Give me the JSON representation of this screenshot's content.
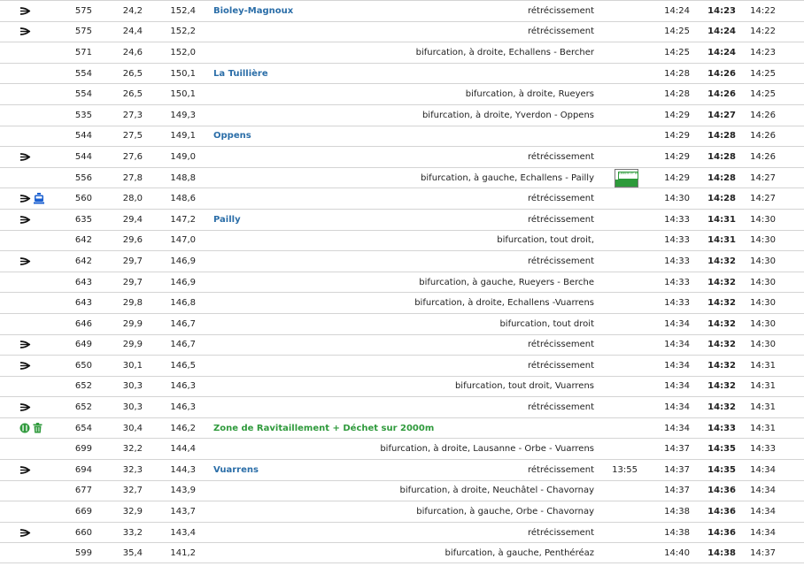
{
  "colors": {
    "place_blue": "#2b6ea8",
    "place_green": "#2f9a3c",
    "row_border": "#d4d4d4"
  },
  "rows": [
    {
      "icons": [
        "narrowing-icon"
      ],
      "alt": "575",
      "km": "24,2",
      "rem": "152,4",
      "place": "Bioley-Magnoux",
      "place_color": "blue",
      "desc": "rétrécissement",
      "t0": "",
      "t1": "14:24",
      "t2": "14:23",
      "t3": "14:22"
    },
    {
      "icons": [
        "narrowing-icon"
      ],
      "alt": "575",
      "km": "24,4",
      "rem": "152,2",
      "place": "",
      "desc": "rétrécissement",
      "t0": "",
      "t1": "14:25",
      "t2": "14:24",
      "t3": "14:22"
    },
    {
      "icons": [],
      "alt": "571",
      "km": "24,6",
      "rem": "152,0",
      "place": "",
      "desc": "bifurcation, à droite, Echallens - Bercher",
      "t0": "",
      "t1": "14:25",
      "t2": "14:24",
      "t3": "14:23"
    },
    {
      "icons": [],
      "alt": "554",
      "km": "26,5",
      "rem": "150,1",
      "place": "La Tuillière",
      "place_color": "blue",
      "desc": "",
      "t0": "",
      "t1": "14:28",
      "t2": "14:26",
      "t3": "14:25"
    },
    {
      "icons": [],
      "alt": "554",
      "km": "26,5",
      "rem": "150,1",
      "place": "",
      "desc": "bifurcation, à droite, Rueyers",
      "t0": "",
      "t1": "14:28",
      "t2": "14:26",
      "t3": "14:25"
    },
    {
      "icons": [],
      "alt": "535",
      "km": "27,3",
      "rem": "149,3",
      "place": "",
      "desc": "bifurcation, à droite, Yverdon - Oppens",
      "t0": "",
      "t1": "14:29",
      "t2": "14:27",
      "t3": "14:26"
    },
    {
      "icons": [],
      "alt": "544",
      "km": "27,5",
      "rem": "149,1",
      "place": "Oppens",
      "place_color": "blue",
      "desc": "",
      "t0": "",
      "t1": "14:29",
      "t2": "14:28",
      "t3": "14:26"
    },
    {
      "icons": [
        "narrowing-icon"
      ],
      "alt": "544",
      "km": "27,6",
      "rem": "149,0",
      "place": "",
      "desc": "rétrécissement",
      "t0": "",
      "t1": "14:29",
      "t2": "14:28",
      "t3": "14:26"
    },
    {
      "icons": [],
      "alt": "556",
      "km": "27,8",
      "rem": "148,8",
      "place": "",
      "desc": "bifurcation, à gauche, Echallens - Pailly",
      "badge": "canton-flag-icon",
      "badge_text": "LIBERTÉ ET PATRIE",
      "t0": "",
      "t1": "14:29",
      "t2": "14:28",
      "t3": "14:27"
    },
    {
      "icons": [
        "narrowing-icon",
        "tram-icon"
      ],
      "alt": "560",
      "km": "28,0",
      "rem": "148,6",
      "place": "",
      "desc": "rétrécissement",
      "t0": "",
      "t1": "14:30",
      "t2": "14:28",
      "t3": "14:27"
    },
    {
      "icons": [
        "narrowing-icon"
      ],
      "alt": "635",
      "km": "29,4",
      "rem": "147,2",
      "place": "Pailly",
      "place_color": "blue",
      "desc": "rétrécissement",
      "t0": "",
      "t1": "14:33",
      "t2": "14:31",
      "t3": "14:30"
    },
    {
      "icons": [],
      "alt": "642",
      "km": "29,6",
      "rem": "147,0",
      "place": "",
      "desc": "bifurcation, tout droit,",
      "t0": "",
      "t1": "14:33",
      "t2": "14:31",
      "t3": "14:30"
    },
    {
      "icons": [
        "narrowing-icon"
      ],
      "alt": "642",
      "km": "29,7",
      "rem": "146,9",
      "place": "",
      "desc": "rétrécissement",
      "t0": "",
      "t1": "14:33",
      "t2": "14:32",
      "t3": "14:30"
    },
    {
      "icons": [],
      "alt": "643",
      "km": "29,7",
      "rem": "146,9",
      "place": "",
      "desc": "bifurcation, à gauche, Rueyers - Berche",
      "t0": "",
      "t1": "14:33",
      "t2": "14:32",
      "t3": "14:30"
    },
    {
      "icons": [],
      "alt": "643",
      "km": "29,8",
      "rem": "146,8",
      "place": "",
      "desc": "bifurcation, à droite, Echallens -Vuarrens",
      "t0": "",
      "t1": "14:33",
      "t2": "14:32",
      "t3": "14:30"
    },
    {
      "icons": [],
      "alt": "646",
      "km": "29,9",
      "rem": "146,7",
      "place": "",
      "desc": "bifurcation, tout droit",
      "t0": "",
      "t1": "14:34",
      "t2": "14:32",
      "t3": "14:30"
    },
    {
      "icons": [
        "narrowing-icon"
      ],
      "alt": "649",
      "km": "29,9",
      "rem": "146,7",
      "place": "",
      "desc": "rétrécissement",
      "t0": "",
      "t1": "14:34",
      "t2": "14:32",
      "t3": "14:30"
    },
    {
      "icons": [
        "narrowing-icon"
      ],
      "alt": "650",
      "km": "30,1",
      "rem": "146,5",
      "place": "",
      "desc": "rétrécissement",
      "t0": "",
      "t1": "14:34",
      "t2": "14:32",
      "t3": "14:31"
    },
    {
      "icons": [],
      "alt": "652",
      "km": "30,3",
      "rem": "146,3",
      "place": "",
      "desc": "bifurcation, tout droit, Vuarrens",
      "t0": "",
      "t1": "14:34",
      "t2": "14:32",
      "t3": "14:31"
    },
    {
      "icons": [
        "narrowing-icon"
      ],
      "alt": "652",
      "km": "30,3",
      "rem": "146,3",
      "place": "",
      "desc": "rétrécissement",
      "t0": "",
      "t1": "14:34",
      "t2": "14:32",
      "t3": "14:31"
    },
    {
      "icons": [
        "feed-zone-icon",
        "trash-icon"
      ],
      "alt": "654",
      "km": "30,4",
      "rem": "146,2",
      "place": "Zone de Ravitaillement + Déchet sur 2000m",
      "place_color": "green",
      "desc": "",
      "t0": "",
      "t1": "14:34",
      "t2": "14:33",
      "t3": "14:31"
    },
    {
      "icons": [],
      "alt": "699",
      "km": "32,2",
      "rem": "144,4",
      "place": "",
      "desc": "bifurcation, à droite, Lausanne - Orbe - Vuarrens",
      "t0": "",
      "t1": "14:37",
      "t2": "14:35",
      "t3": "14:33"
    },
    {
      "icons": [
        "narrowing-icon"
      ],
      "alt": "694",
      "km": "32,3",
      "rem": "144,3",
      "place": "Vuarrens",
      "place_color": "blue",
      "desc": "rétrécissement",
      "t0": "13:55",
      "t1": "14:37",
      "t2": "14:35",
      "t3": "14:34"
    },
    {
      "icons": [],
      "alt": "677",
      "km": "32,7",
      "rem": "143,9",
      "place": "",
      "desc": "bifurcation, à droite, Neuchâtel - Chavornay",
      "t0": "",
      "t1": "14:37",
      "t2": "14:36",
      "t3": "14:34"
    },
    {
      "icons": [],
      "alt": "669",
      "km": "32,9",
      "rem": "143,7",
      "place": "",
      "desc": "bifurcation, à gauche, Orbe - Chavornay",
      "t0": "",
      "t1": "14:38",
      "t2": "14:36",
      "t3": "14:34"
    },
    {
      "icons": [
        "narrowing-icon"
      ],
      "alt": "660",
      "km": "33,2",
      "rem": "143,4",
      "place": "",
      "desc": "rétrécissement",
      "t0": "",
      "t1": "14:38",
      "t2": "14:36",
      "t3": "14:34"
    },
    {
      "icons": [],
      "alt": "599",
      "km": "35,4",
      "rem": "141,2",
      "place": "",
      "desc": "bifurcation, à gauche, Penthéréaz",
      "t0": "",
      "t1": "14:40",
      "t2": "14:38",
      "t3": "14:37"
    }
  ]
}
